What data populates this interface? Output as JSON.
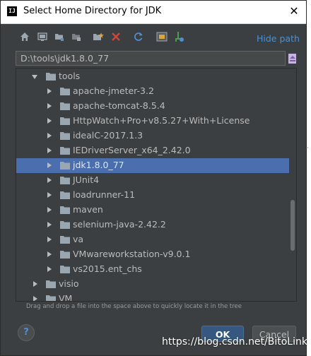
{
  "window": {
    "title": "Select Home Directory for JDK",
    "app_icon_text": "IJ"
  },
  "toolbar": {
    "icons": [
      "home-icon",
      "desktop-icon",
      "project-icon",
      "module-icon",
      "new-folder-icon",
      "delete-icon",
      "refresh-icon",
      "show-hidden-icon",
      "add-to-favorites-icon"
    ],
    "hide_path_label": "Hide path"
  },
  "path": {
    "value": "D:\\tools\\jdk1.8.0_77"
  },
  "tree": {
    "parent": {
      "label": "tools",
      "expanded": true
    },
    "children": [
      {
        "label": "apache-jmeter-3.2",
        "selected": false
      },
      {
        "label": "apache-tomcat-8.5.4",
        "selected": false
      },
      {
        "label": "HttpWatch+Pro+v8.5.27+With+License",
        "selected": false
      },
      {
        "label": "idealC-2017.1.3",
        "selected": false
      },
      {
        "label": "IEDriverServer_x64_2.42.0",
        "selected": false
      },
      {
        "label": "jdk1.8.0_77",
        "selected": true
      },
      {
        "label": "JUnit4",
        "selected": false
      },
      {
        "label": "loadrunner-11",
        "selected": false
      },
      {
        "label": "maven",
        "selected": false
      },
      {
        "label": "selenium-java-2.42.2",
        "selected": false
      },
      {
        "label": "va",
        "selected": false
      },
      {
        "label": "VMwareworkstation-v9.0.1",
        "selected": false
      },
      {
        "label": "vs2015.ent_chs",
        "selected": false
      }
    ],
    "siblings": [
      {
        "label": "visio"
      },
      {
        "label": "VM"
      }
    ]
  },
  "hint_text": "Drag and drop a file into the space above to quickly locate it in the tree",
  "buttons": {
    "help": "?",
    "ok": "OK",
    "cancel": "Cancel"
  },
  "watermark": "https://blog.csdn.net/BitoLink",
  "colors": {
    "background": "#3c3f41",
    "selection": "#4b6eaf",
    "link": "#4d90d0",
    "folder": "#9aa7b0"
  }
}
